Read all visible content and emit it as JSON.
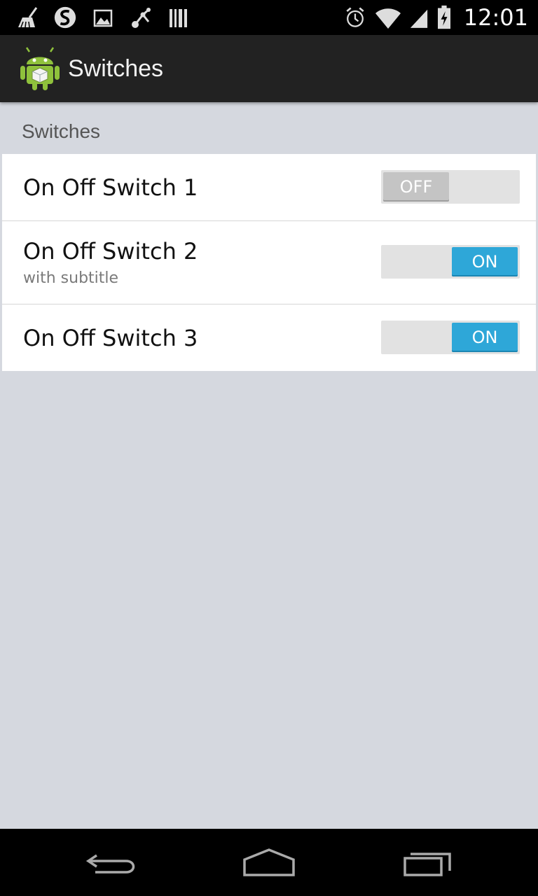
{
  "status_bar": {
    "time": "12:01",
    "left_icons": [
      "cleaner-icon",
      "s-logo-icon",
      "image-icon",
      "graph-icon",
      "barcode-icon"
    ],
    "right_icons": [
      "alarm-icon",
      "wifi-icon",
      "signal-icon",
      "battery-charging-icon"
    ]
  },
  "action_bar": {
    "app_icon": "android-app-icon",
    "title": "Switches"
  },
  "category": {
    "title": "Switches"
  },
  "preferences": [
    {
      "title": "On Off Switch 1",
      "subtitle": "",
      "state": "OFF",
      "checked": false
    },
    {
      "title": "On Off Switch 2",
      "subtitle": "with subtitle",
      "state": "ON",
      "checked": true
    },
    {
      "title": "On Off Switch 3",
      "subtitle": "",
      "state": "ON",
      "checked": true
    }
  ],
  "nav_bar": {
    "buttons": [
      "back-icon",
      "home-icon",
      "recent-apps-icon"
    ]
  },
  "colors": {
    "switch_on": "#2ea7d8",
    "switch_off": "#c4c4c4",
    "background": "#d5d8df",
    "action_bar": "#222222"
  }
}
